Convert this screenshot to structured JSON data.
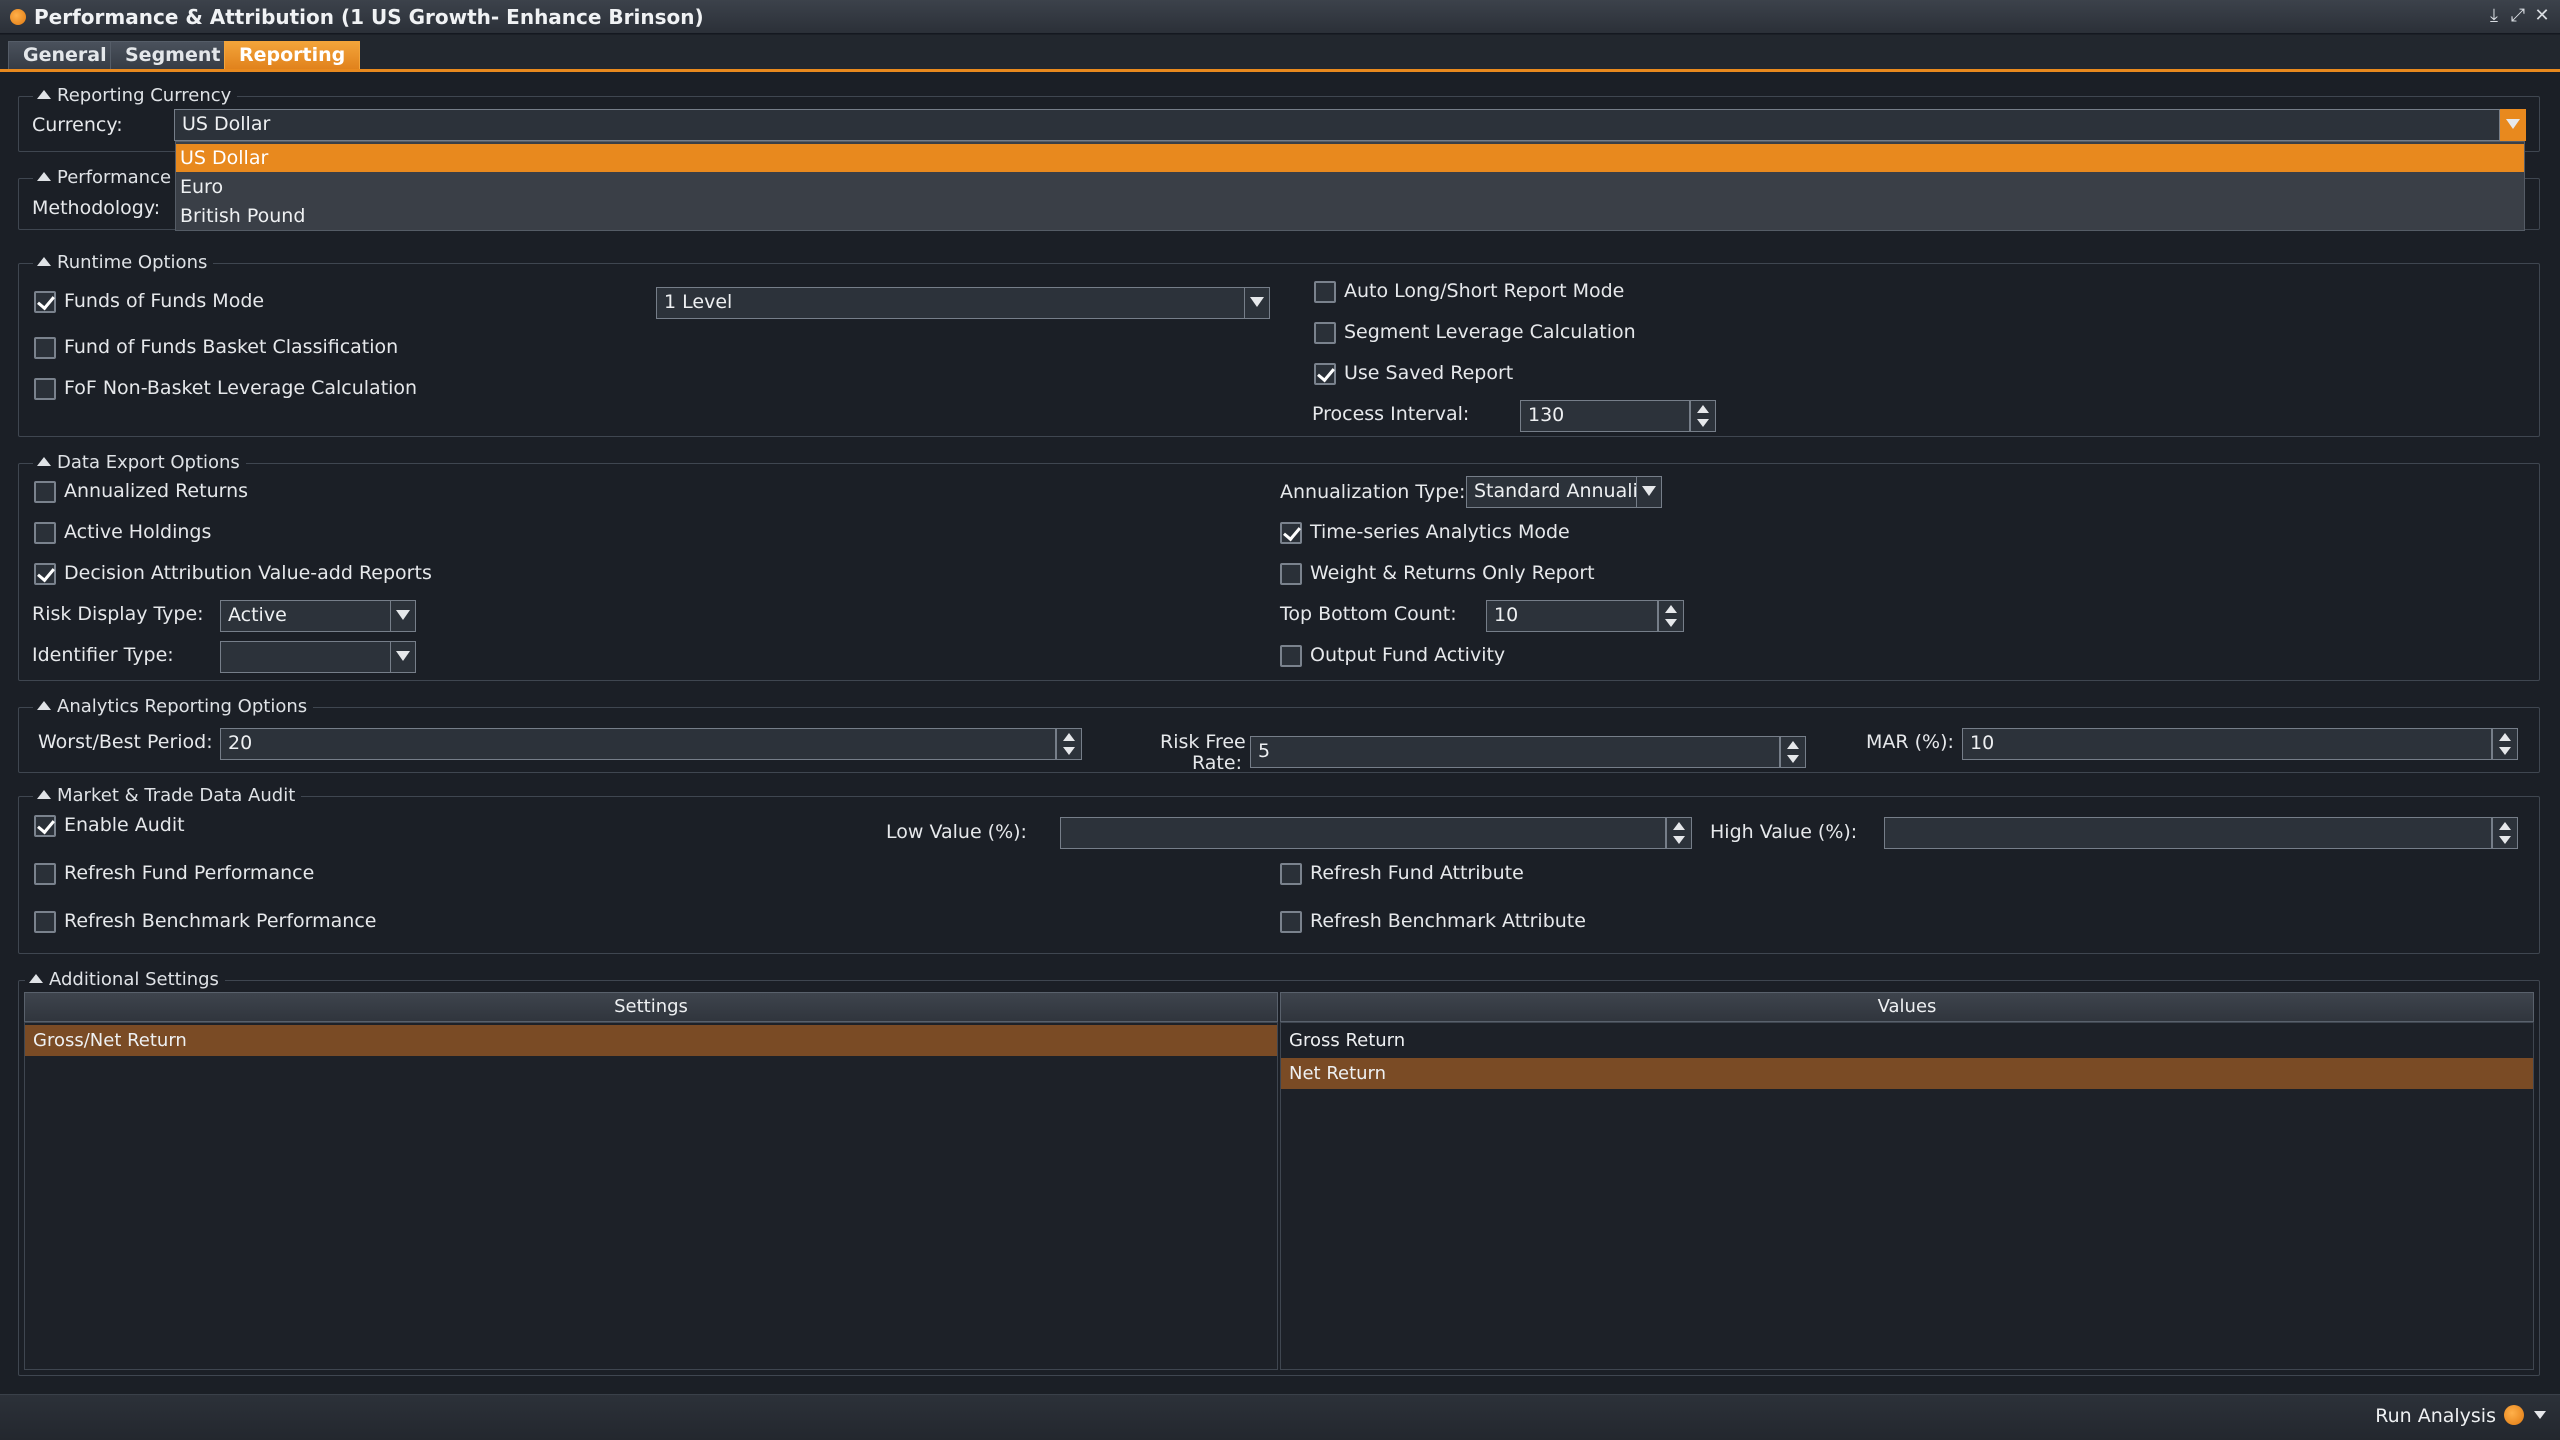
{
  "window": {
    "title": "Performance & Attribution (1 US Growth- Enhance Brinson)"
  },
  "tabs": [
    "General",
    "Segment",
    "Reporting"
  ],
  "reporting_currency": {
    "title": "Reporting Currency",
    "currency_label": "Currency:",
    "currency_value": "US Dollar",
    "options": [
      "US Dollar",
      "Euro",
      "British Pound"
    ]
  },
  "performance": {
    "title": "Performance",
    "methodology_label": "Methodology:"
  },
  "runtime": {
    "title": "Runtime Options",
    "funds_of_funds_mode": "Funds of Funds Mode",
    "level_value": "1 Level",
    "basket_classification": "Fund of Funds Basket Classification",
    "non_basket_leverage": "FoF Non-Basket Leverage Calculation",
    "auto_long_short": "Auto Long/Short Report Mode",
    "segment_leverage": "Segment Leverage Calculation",
    "use_saved_report": "Use Saved Report",
    "process_interval_label": "Process Interval:",
    "process_interval_value": "130"
  },
  "export": {
    "title": "Data Export Options",
    "annualized_returns": "Annualized Returns",
    "active_holdings": "Active Holdings",
    "decision_attribution": "Decision Attribution Value-add Reports",
    "risk_display_label": "Risk Display Type:",
    "risk_display_value": "Active",
    "identifier_label": "Identifier Type:",
    "identifier_value": "",
    "annualization_label": "Annualization Type:",
    "annualization_value": "Standard Annualiz",
    "time_series": "Time-series Analytics Mode",
    "weight_returns_only": "Weight & Returns Only Report",
    "top_bottom_label": "Top Bottom Count:",
    "top_bottom_value": "10",
    "output_fund_activity": "Output Fund Activity"
  },
  "analytics": {
    "title": "Analytics Reporting Options",
    "worst_best_label": "Worst/Best Period:",
    "worst_best_value": "20",
    "risk_free_label_1": "Risk Free",
    "risk_free_label_2": "Rate:",
    "risk_free_value": "5",
    "mar_label": "MAR (%):",
    "mar_value": "10"
  },
  "audit": {
    "title": "Market & Trade Data Audit",
    "enable_audit": "Enable Audit",
    "low_value_label": "Low Value (%):",
    "high_value_label": "High Value (%):",
    "refresh_fund_performance": "Refresh Fund Performance",
    "refresh_benchmark_performance": "Refresh Benchmark Performance",
    "refresh_fund_attribute": "Refresh Fund Attribute",
    "refresh_benchmark_attribute": "Refresh Benchmark Attribute"
  },
  "additional": {
    "title": "Additional Settings",
    "settings_header": "Settings",
    "values_header": "Values",
    "settings_rows": [
      "Gross/Net Return"
    ],
    "value_rows": [
      "Gross Return",
      "Net Return"
    ]
  },
  "status": {
    "run_analysis": "Run Analysis"
  },
  "colors": {
    "accent": "#e8891e",
    "highlight_row": "#7a4b25",
    "background": "#1b1f26"
  }
}
